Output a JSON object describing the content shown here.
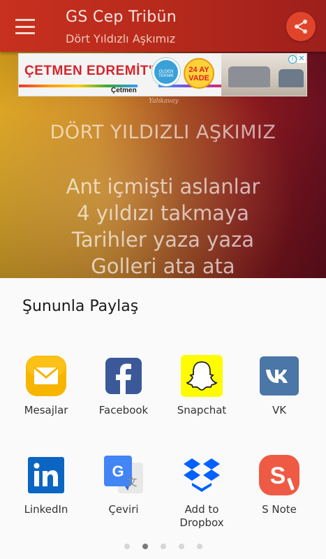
{
  "app_bar": {
    "title": "GS Cep Tribün",
    "subtitle": "Dört Yıldızlı Aşkımız",
    "menu_icon": "hamburger-menu-icon",
    "share_icon": "share-icon",
    "bar_color": "#b72a1c",
    "share_color": "#e0452c"
  },
  "ad_banner": {
    "brand_text": "ÇETMEN EDREMİT'TE",
    "logo_text": "Çetmen",
    "badge_left_text": "OLDEN TEKNİK",
    "badge_right_line1": "24 AY",
    "badge_right_line2": "VADE",
    "info_icon": "ad-info-icon",
    "close_icon": "ad-close-icon"
  },
  "watermark": "Yalıkavay",
  "lyrics": {
    "title": "DÖRT YILDIZLI AŞKIMIZ",
    "lines": [
      "Ant içmişti aslanlar",
      "4 yıldızı takmaya",
      "Tarihler yaza yaza",
      "Golleri ata ata"
    ]
  },
  "share_sheet": {
    "title": "Şununla Paylaş",
    "apps": [
      {
        "label": "Mesajlar",
        "icon": "messages-envelope-icon",
        "color": "#f5b400"
      },
      {
        "label": "Facebook",
        "icon": "facebook-icon",
        "color": "#3b5998"
      },
      {
        "label": "Snapchat",
        "icon": "snapchat-ghost-icon",
        "color": "#fffc00"
      },
      {
        "label": "VK",
        "icon": "vk-icon",
        "color": "#4a76a8"
      },
      {
        "label": "LinkedIn",
        "icon": "linkedin-icon",
        "color": "#0a66c2"
      },
      {
        "label": "Çeviri",
        "icon": "google-translate-icon",
        "color": "#4285f4"
      },
      {
        "label": "Add to\nDropbox",
        "icon": "dropbox-icon",
        "color": "#0061ff"
      },
      {
        "label": "S Note",
        "icon": "s-note-icon",
        "color": "#ef5a45"
      }
    ],
    "pages": 5,
    "current_page": 2
  }
}
